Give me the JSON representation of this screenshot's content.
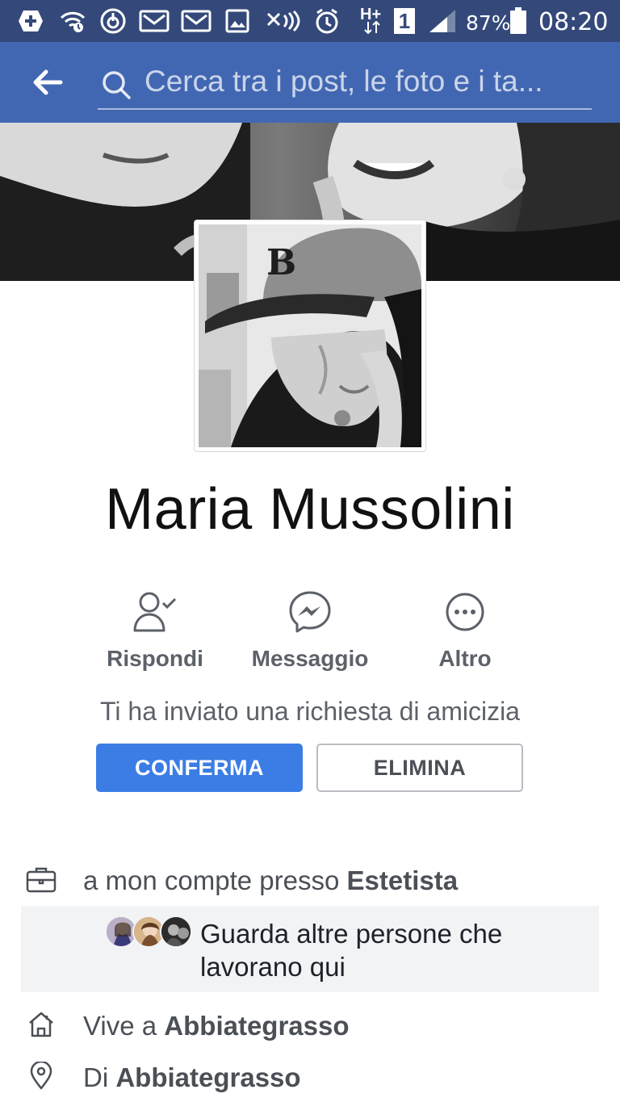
{
  "status_bar": {
    "battery": "87%",
    "time": "08:20",
    "network": "H+",
    "sim": "1"
  },
  "search": {
    "placeholder": "Cerca tra i post, le foto e i ta..."
  },
  "profile": {
    "name": "Maria Mussolini"
  },
  "actions": [
    {
      "label": "Rispondi",
      "icon": "person-check-icon"
    },
    {
      "label": "Messaggio",
      "icon": "messenger-icon"
    },
    {
      "label": "Altro",
      "icon": "more-icon"
    }
  ],
  "friend_request": {
    "text": "Ti ha inviato una richiesta di amicizia",
    "confirm_label": "CONFERMA",
    "delete_label": "ELIMINA"
  },
  "intro": {
    "work_prefix": "a mon compte presso ",
    "work_place": "Estetista",
    "coworkers_text": "Guarda altre persone che lavorano qui",
    "lives_prefix": "Vive a ",
    "lives_place": "Abbiategrasso",
    "from_prefix": "Di ",
    "from_place": "Abbiategrasso"
  },
  "colors": {
    "status_bar": "#34497a",
    "header": "#4267b2",
    "confirm": "#3b7de5"
  }
}
